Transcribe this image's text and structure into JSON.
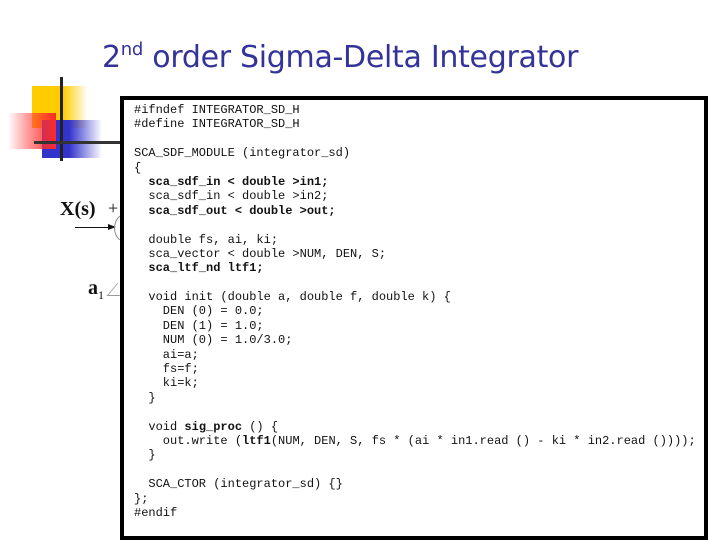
{
  "slide": {
    "title_prefix": "2",
    "title_superscript": "nd",
    "title_rest": " order Sigma-Delta Integrator",
    "title_color": "#333399",
    "diagram": {
      "input_label": "X(s)",
      "plus_sign": "+",
      "gain_label": "a",
      "gain_subscript": "1"
    },
    "code_lines": [
      [
        {
          "t": "#ifndef INTEGRATOR_SD_H"
        }
      ],
      [
        {
          "t": "#define INTEGRATOR_SD_H"
        }
      ],
      [
        {
          "t": ""
        }
      ],
      [
        {
          "t": "SCA_SDF_MODULE (integrator_sd)"
        }
      ],
      [
        {
          "t": "{"
        }
      ],
      [
        {
          "t": "  "
        },
        {
          "t": "sca_sdf_in < double >in1;",
          "b": true
        }
      ],
      [
        {
          "t": "  sca_sdf_in < double >in2;"
        }
      ],
      [
        {
          "t": "  "
        },
        {
          "t": "sca_sdf_out < double >out;",
          "b": true
        }
      ],
      [
        {
          "t": ""
        }
      ],
      [
        {
          "t": "  double fs, ai, ki;"
        }
      ],
      [
        {
          "t": "  sca_vector < double >NUM, DEN, S;"
        }
      ],
      [
        {
          "t": "  "
        },
        {
          "t": "sca_ltf_nd ltf1;",
          "b": true
        }
      ],
      [
        {
          "t": ""
        }
      ],
      [
        {
          "t": "  void init (double a, double f, double k) {"
        }
      ],
      [
        {
          "t": "    DEN (0) = 0.0;"
        }
      ],
      [
        {
          "t": "    DEN (1) = 1.0;"
        }
      ],
      [
        {
          "t": "    NUM (0) = 1.0/3.0;"
        }
      ],
      [
        {
          "t": "    ai=a;"
        }
      ],
      [
        {
          "t": "    fs=f;"
        }
      ],
      [
        {
          "t": "    ki=k;"
        }
      ],
      [
        {
          "t": "  }"
        }
      ],
      [
        {
          "t": ""
        }
      ],
      [
        {
          "t": "  void "
        },
        {
          "t": "sig_proc",
          "b": true
        },
        {
          "t": " () {"
        }
      ],
      [
        {
          "t": "    out.write ("
        },
        {
          "t": "ltf1",
          "b": true
        },
        {
          "t": "(NUM, DEN, S, fs * (ai * in1.read () - ki * in2.read ())));"
        }
      ],
      [
        {
          "t": "  }"
        }
      ],
      [
        {
          "t": ""
        }
      ],
      [
        {
          "t": "  SCA_CTOR (integrator_sd) {}"
        }
      ],
      [
        {
          "t": "};"
        }
      ],
      [
        {
          "t": "#endif"
        }
      ]
    ]
  }
}
